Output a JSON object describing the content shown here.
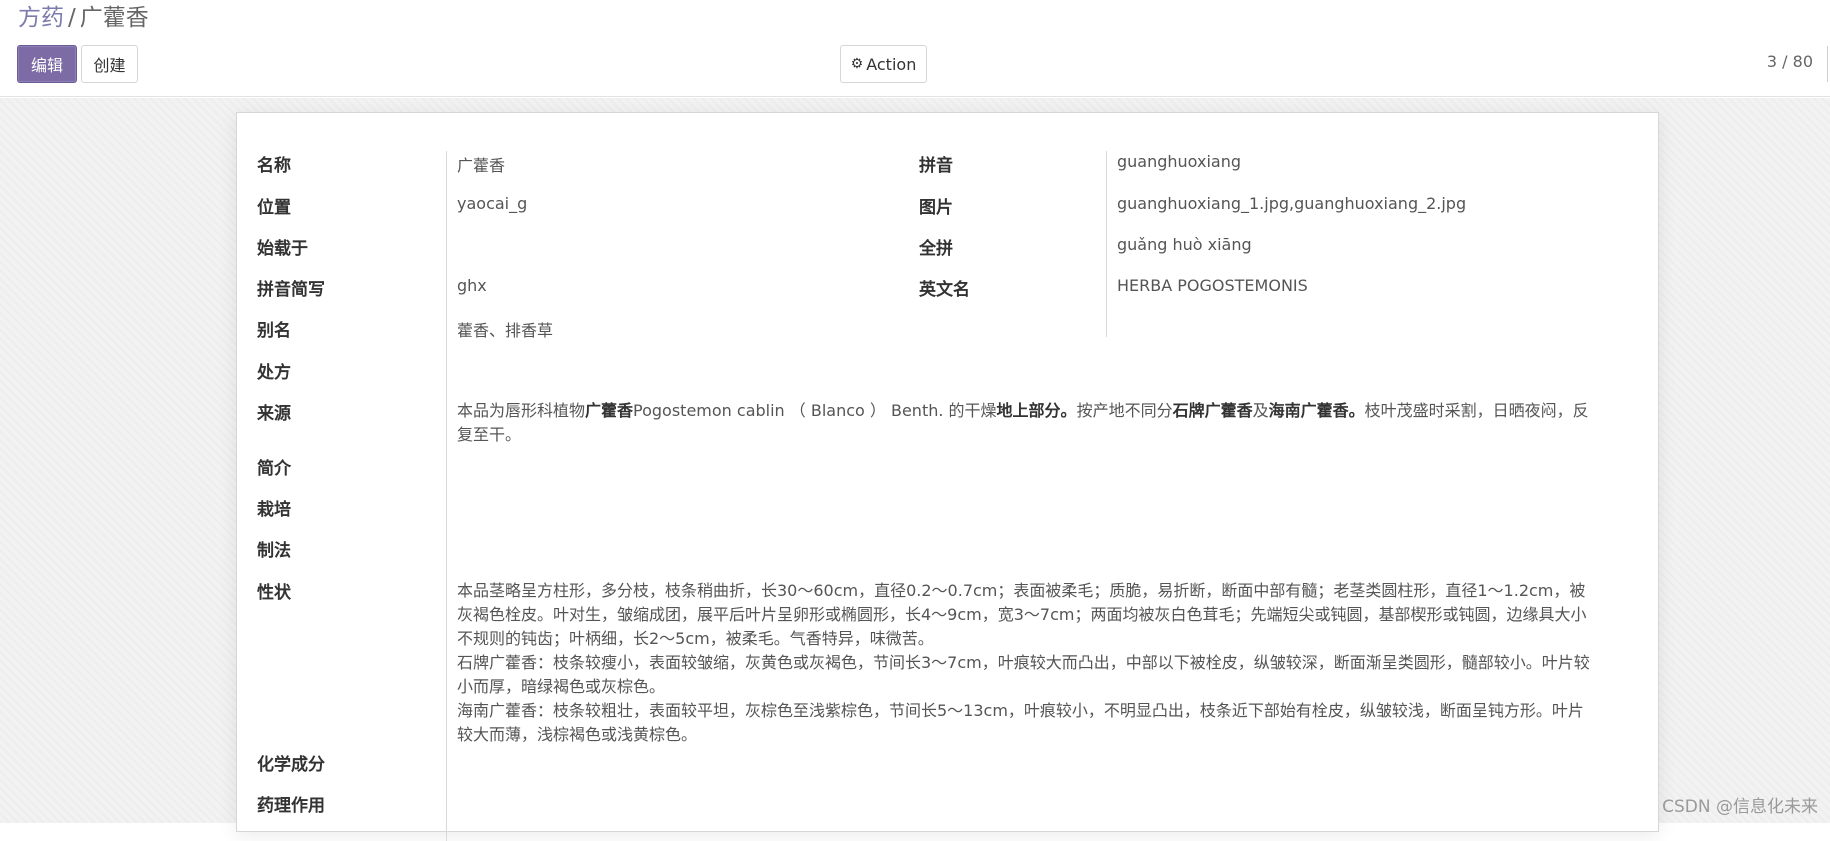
{
  "breadcrumb": {
    "parent": "方药",
    "separator": "/",
    "current": "广藿香"
  },
  "toolbar": {
    "edit_label": "编辑",
    "create_label": "创建",
    "action_label": "Action"
  },
  "pager": {
    "text": "3 / 80"
  },
  "form": {
    "name_label": "名称",
    "name_value": "广藿香",
    "pinyin_label": "拼音",
    "pinyin_value": "guanghuoxiang",
    "location_label": "位置",
    "location_value": "yaocai_g",
    "image_label": "图片",
    "image_value": "guanghuoxiang_1.jpg,guanghuoxiang_2.jpg",
    "origin_label": "始载于",
    "origin_value": "",
    "fullpinyin_label": "全拼",
    "fullpinyin_value": "guǎng huò xiāng",
    "abbr_label": "拼音简写",
    "abbr_value": "ghx",
    "english_label": "英文名",
    "english_value": "HERBA POGOSTEMONIS",
    "alias_label": "别名",
    "alias_value": "藿香、排香草",
    "prescription_label": "处方",
    "source_label": "来源",
    "source_segments": [
      {
        "text": "本品为唇形科植物",
        "bold": false
      },
      {
        "text": "广藿香",
        "bold": true
      },
      {
        "text": "Pogostemon cablin （ Blanco ） Benth. 的干燥",
        "bold": false
      },
      {
        "text": "地上部分。",
        "bold": true
      },
      {
        "text": "按产地不同分",
        "bold": false
      },
      {
        "text": "石牌广藿香",
        "bold": true
      },
      {
        "text": "及",
        "bold": false
      },
      {
        "text": "海南广藿香。",
        "bold": true
      },
      {
        "text": "枝叶茂盛时采割，日晒夜闷，反复至干。",
        "bold": false
      }
    ],
    "intro_label": "简介",
    "cultivation_label": "栽培",
    "processing_label": "制法",
    "properties_label": "性状",
    "properties_p1": "本品茎略呈方柱形，多分枝，枝条稍曲折，长30～60cm，直径0.2～0.7cm；表面被柔毛；质脆，易折断，断面中部有髓；老茎类圆柱形，直径1～1.2cm，被灰褐色栓皮。叶对生，皱缩成团，展平后叶片呈卵形或椭圆形，长4～9cm，宽3～7cm；两面均被灰白色茸毛；先端短尖或钝圆，基部楔形或钝圆，边缘具大小不规则的钝齿；叶柄细，长2～5cm，被柔毛。气香特异，味微苦。",
    "properties_p2": "石牌广藿香：枝条较瘦小，表面较皱缩，灰黄色或灰褐色，节间长3～7cm，叶痕较大而凸出，中部以下被栓皮，纵皱较深，断面渐呈类圆形，髓部较小。叶片较小而厚，暗绿褐色或灰棕色。",
    "properties_p3": "海南广藿香：枝条较粗壮，表面较平坦，灰棕色至浅紫棕色，节间长5～13cm，叶痕较小，不明显凸出，枝条近下部始有栓皮，纵皱较浅，断面呈钝方形。叶片较大而薄，浅棕褐色或浅黄棕色。",
    "chemistry_label": "化学成分",
    "pharmacology_label": "药理作用"
  },
  "watermark": "CSDN @信息化未来",
  "colors": {
    "primary": "#7c6ba4",
    "link": "#7c7bad"
  }
}
